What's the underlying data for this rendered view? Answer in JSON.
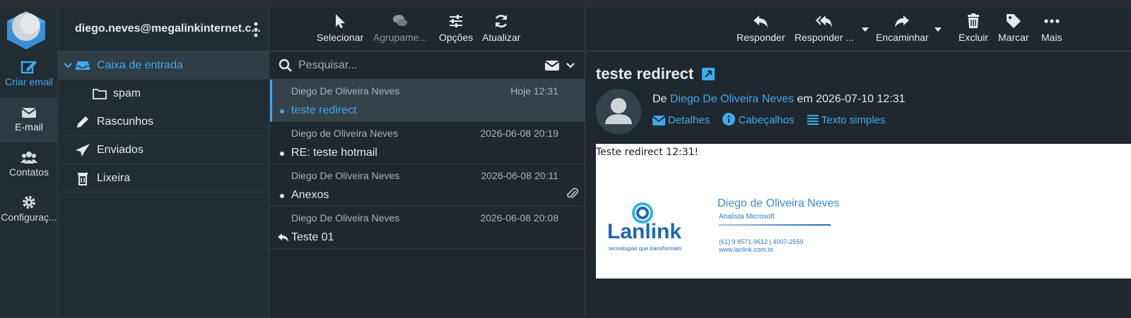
{
  "nav": {
    "items": [
      {
        "label": "Criar email",
        "icon": "compose-icon"
      },
      {
        "label": "E-mail",
        "icon": "envelope-icon"
      },
      {
        "label": "Contatos",
        "icon": "users-icon"
      },
      {
        "label": "Configuraç...",
        "icon": "gear-icon"
      }
    ]
  },
  "account": {
    "email": "diego.neves@megalinkinternet.c..."
  },
  "folders": [
    {
      "label": "Caixa de entrada",
      "icon": "inbox-icon"
    },
    {
      "label": "spam",
      "icon": "folder-icon"
    },
    {
      "label": "Rascunhos",
      "icon": "pencil-icon"
    },
    {
      "label": "Enviados",
      "icon": "paper-plane-icon"
    },
    {
      "label": "Lixeira",
      "icon": "trash-icon"
    }
  ],
  "list_toolbar": {
    "select": "Selecionar",
    "group": "Agrupame...",
    "options": "Opções",
    "refresh": "Atualizar"
  },
  "search": {
    "placeholder": "Pesquisar..."
  },
  "messages": [
    {
      "from": "Diego De Oliveira Neves",
      "date": "Hoje 12:31",
      "subject": "teste redirect",
      "selected": true,
      "unread": true
    },
    {
      "from": "Diego de Oliveira Neves",
      "date": "2026-06-08 20:19",
      "subject": "RE: teste hotmail",
      "unread": true
    },
    {
      "from": "Diego De Oliveira Neves",
      "date": "2026-06-08 20:11",
      "subject": "Anexos",
      "unread": true,
      "attachment": true
    },
    {
      "from": "Diego De Oliveira Neves",
      "date": "2026-06-08 20:08",
      "subject": "Teste 01",
      "replied": true
    }
  ],
  "reader_toolbar": {
    "reply": "Responder",
    "reply_all": "Responder ...",
    "forward": "Encaminhar",
    "delete": "Excluir",
    "mark": "Marcar",
    "more": "Mais"
  },
  "message": {
    "subject": "teste redirect",
    "from_prefix": "De",
    "sender": "Diego De Oliveira Neves",
    "on": "em",
    "datetime": "2026-07-10 12:31",
    "details": "Detalhes",
    "headers": "Cabeçalhos",
    "plain": "Texto simples",
    "body_text": "Teste redirect 12:31!",
    "signature": {
      "brand": "Lanlink",
      "tagline": "tecnologias que transformam",
      "name": "Diego de Oliveira Neves",
      "role": "Analista Microsoft",
      "phone": "(61) 9 8571-9612 | 4007-2559",
      "web": "www.lanlink.com.br"
    }
  },
  "colors": {
    "accent": "#3da9ee",
    "background": "#1f282e",
    "panel": "#222d33"
  }
}
